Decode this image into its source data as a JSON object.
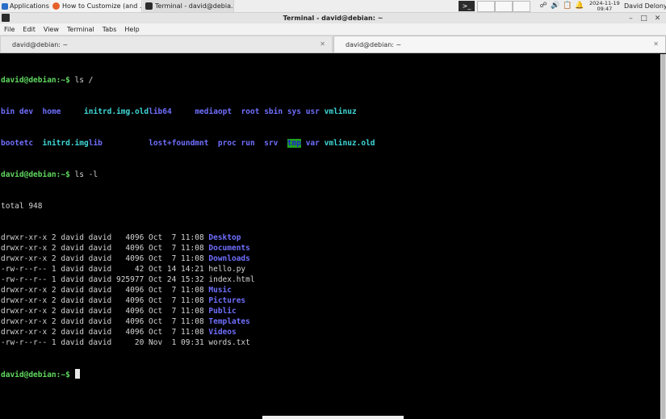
{
  "panel": {
    "apps_label": "Applications",
    "tasks": [
      {
        "label": "How to Customize (and ..."
      },
      {
        "label": "Terminal - david@debia..."
      }
    ],
    "date": "2024-11-19",
    "time": "09:47",
    "user": "David Delony"
  },
  "window": {
    "title": "Terminal - david@debian: ~"
  },
  "menu": [
    "File",
    "Edit",
    "View",
    "Terminal",
    "Tabs",
    "Help"
  ],
  "tabs": [
    {
      "label": "david@debian: ~",
      "active": false
    },
    {
      "label": "david@debian: ~",
      "active": true
    }
  ],
  "terminal": {
    "prompt": "david@debian:~$",
    "cmd1": " ls /",
    "root_row1": [
      "bin",
      "dev",
      "home",
      "initrd.img.old",
      "lib64",
      "media",
      "opt",
      "root",
      "sbin",
      "sys",
      "usr",
      "vmlinuz"
    ],
    "root_row2": [
      "boot",
      "etc",
      "initrd.img",
      "lib",
      "lost+found",
      "mnt",
      "proc",
      "run",
      "srv",
      "tmp",
      "var",
      "vmlinuz.old"
    ],
    "cmd2": " ls -l",
    "total": "total 948",
    "entries": [
      {
        "meta": "drwxr-xr-x 2 david david   4096 Oct  7 11:08 ",
        "name": "Desktop",
        "type": "dir"
      },
      {
        "meta": "drwxr-xr-x 2 david david   4096 Oct  7 11:08 ",
        "name": "Documents",
        "type": "dir"
      },
      {
        "meta": "drwxr-xr-x 2 david david   4096 Oct  7 11:08 ",
        "name": "Downloads",
        "type": "dir"
      },
      {
        "meta": "-rw-r--r-- 1 david david     42 Oct 14 14:21 ",
        "name": "hello.py",
        "type": "file"
      },
      {
        "meta": "-rw-r--r-- 1 david david 925977 Oct 24 15:32 ",
        "name": "index.html",
        "type": "file"
      },
      {
        "meta": "drwxr-xr-x 2 david david   4096 Oct  7 11:08 ",
        "name": "Music",
        "type": "dir"
      },
      {
        "meta": "drwxr-xr-x 2 david david   4096 Oct  7 11:08 ",
        "name": "Pictures",
        "type": "dir"
      },
      {
        "meta": "drwxr-xr-x 2 david david   4096 Oct  7 11:08 ",
        "name": "Public",
        "type": "dir"
      },
      {
        "meta": "drwxr-xr-x 2 david david   4096 Oct  7 11:08 ",
        "name": "Templates",
        "type": "dir"
      },
      {
        "meta": "drwxr-xr-x 2 david david   4096 Oct  7 11:08 ",
        "name": "Videos",
        "type": "dir"
      },
      {
        "meta": "-rw-r--r-- 1 david david     20 Nov  1 09:31 ",
        "name": "words.txt",
        "type": "file"
      }
    ]
  },
  "icons": {
    "apps": "xfce-mouse-icon",
    "browser": "firefox-icon",
    "terminal": "terminal-icon",
    "tray": [
      "network-icon",
      "volume-icon",
      "clipboard-icon",
      "notification-bell-icon"
    ]
  },
  "colors": {
    "prompt": "#5fd75f",
    "directory": "#6f6fff",
    "symlink": "#3fd7d7",
    "tmp_bg": "#1fa11f",
    "terminal_bg": "#000000"
  }
}
